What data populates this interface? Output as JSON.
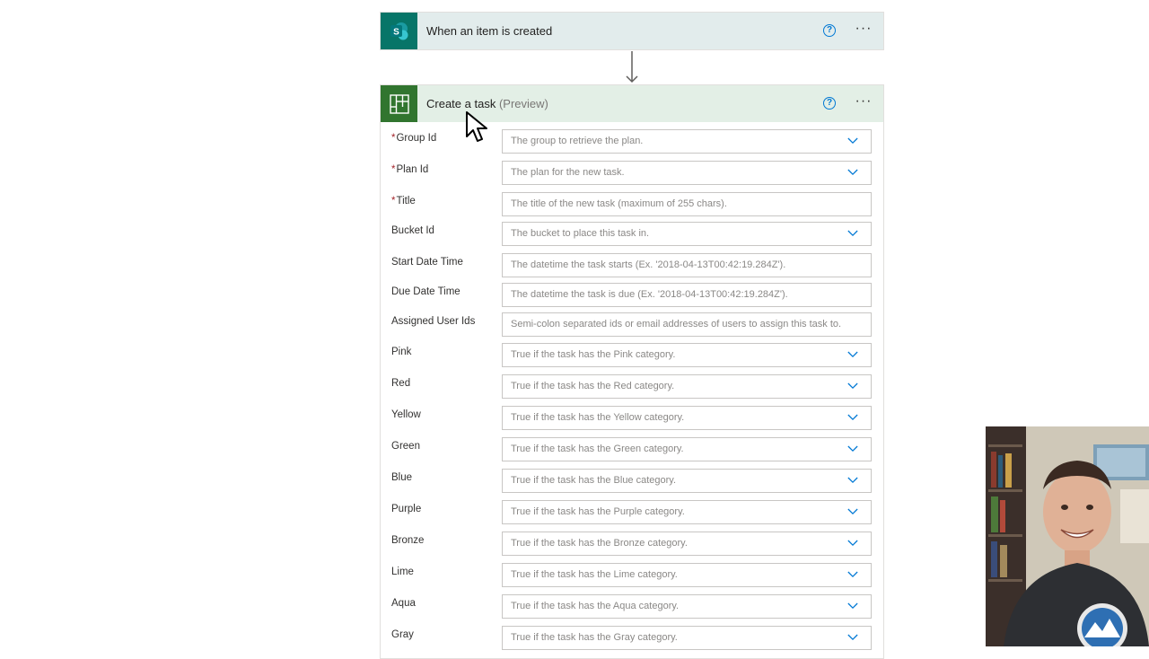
{
  "trigger": {
    "title": "When an item is created",
    "logo_letter": "S",
    "icon": "sharepoint-icon",
    "help_glyph": "?",
    "more_glyph": "···"
  },
  "action": {
    "title": "Create a task",
    "title_suffix": "(Preview)",
    "icon": "planner-icon",
    "help_glyph": "?",
    "more_glyph": "···"
  },
  "fields": [
    {
      "label": "Group Id",
      "required": true,
      "placeholder": "The group to retrieve the plan.",
      "dropdown": true
    },
    {
      "label": "Plan Id",
      "required": true,
      "placeholder": "The plan for the new task.",
      "dropdown": true
    },
    {
      "label": "Title",
      "required": true,
      "placeholder": "The title of the new task (maximum of 255 chars).",
      "dropdown": false
    },
    {
      "label": "Bucket Id",
      "required": false,
      "placeholder": "The bucket to place this task in.",
      "dropdown": true
    },
    {
      "label": "Start Date Time",
      "required": false,
      "placeholder": "The datetime the task starts (Ex. '2018-04-13T00:42:19.284Z').",
      "dropdown": false
    },
    {
      "label": "Due Date Time",
      "required": false,
      "placeholder": "The datetime the task is due (Ex. '2018-04-13T00:42:19.284Z').",
      "dropdown": false
    },
    {
      "label": "Assigned User Ids",
      "required": false,
      "placeholder": "Semi-colon separated ids or email addresses of users to assign this task to.",
      "dropdown": false
    },
    {
      "label": "Pink",
      "required": false,
      "placeholder": "True if the task has the Pink category.",
      "dropdown": true
    },
    {
      "label": "Red",
      "required": false,
      "placeholder": "True if the task has the Red category.",
      "dropdown": true
    },
    {
      "label": "Yellow",
      "required": false,
      "placeholder": "True if the task has the Yellow category.",
      "dropdown": true
    },
    {
      "label": "Green",
      "required": false,
      "placeholder": "True if the task has the Green category.",
      "dropdown": true
    },
    {
      "label": "Blue",
      "required": false,
      "placeholder": "True if the task has the Blue category.",
      "dropdown": true
    },
    {
      "label": "Purple",
      "required": false,
      "placeholder": "True if the task has the Purple category.",
      "dropdown": true
    },
    {
      "label": "Bronze",
      "required": false,
      "placeholder": "True if the task has the Bronze category.",
      "dropdown": true
    },
    {
      "label": "Lime",
      "required": false,
      "placeholder": "True if the task has the Lime category.",
      "dropdown": true
    },
    {
      "label": "Aqua",
      "required": false,
      "placeholder": "True if the task has the Aqua category.",
      "dropdown": true
    },
    {
      "label": "Gray",
      "required": false,
      "placeholder": "True if the task has the Gray category.",
      "dropdown": true
    }
  ],
  "required_marker": "*",
  "colors": {
    "sharepoint": "#077568",
    "planner": "#31752f",
    "accent": "#0078d4",
    "required": "#a4262c"
  }
}
